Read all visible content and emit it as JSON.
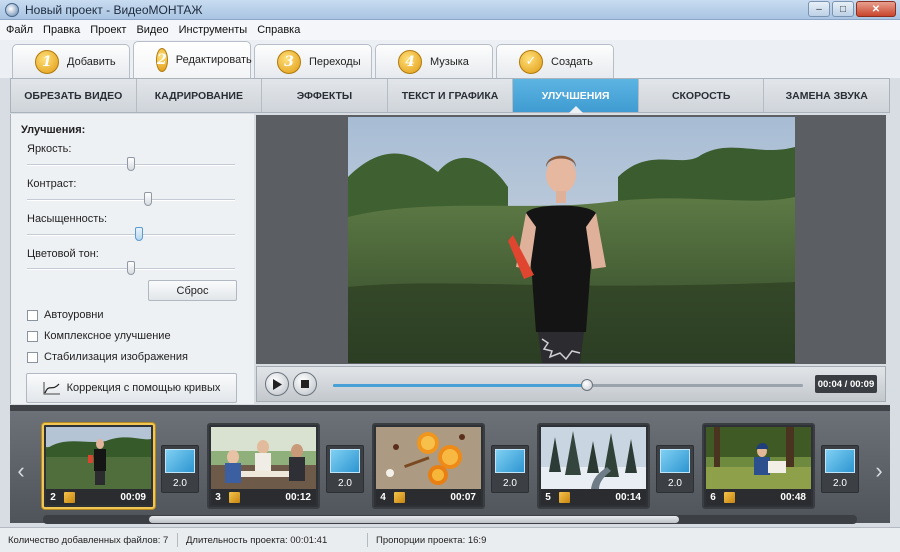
{
  "window": {
    "title": "Новый проект - ВидеоМОНТАЖ",
    "controls": [
      "minimize",
      "maximize",
      "close"
    ]
  },
  "menu": [
    "Файл",
    "Правка",
    "Проект",
    "Видео",
    "Инструменты",
    "Справка"
  ],
  "steps": [
    {
      "num": "1",
      "label": "Добавить"
    },
    {
      "num": "2",
      "label": "Редактировать",
      "active": true
    },
    {
      "num": "3",
      "label": "Переходы"
    },
    {
      "num": "4",
      "label": "Музыка"
    },
    {
      "num": "✓",
      "label": "Создать"
    }
  ],
  "subtabs": [
    "ОБРЕЗАТЬ ВИДЕО",
    "КАДРИРОВАНИЕ",
    "ЭФФЕКТЫ",
    "ТЕКСТ И ГРАФИКА",
    "УЛУЧШЕНИЯ",
    "СКОРОСТЬ",
    "ЗАМЕНА ЗВУКА"
  ],
  "active_subtab": "УЛУЧШЕНИЯ",
  "enhance": {
    "title": "Улучшения:",
    "sliders": [
      {
        "label": "Яркость:",
        "value": 0.5
      },
      {
        "label": "Контраст:",
        "value": 0.58
      },
      {
        "label": "Насыщенность:",
        "value": 0.54
      },
      {
        "label": "Цветовой тон:",
        "value": 0.5
      }
    ],
    "reset_label": "Сброс",
    "checkboxes": [
      {
        "label": "Автоуровни",
        "checked": false
      },
      {
        "label": "Комплексное улучшение",
        "checked": false
      },
      {
        "label": "Стабилизация изображения",
        "checked": false
      }
    ],
    "curves_label": "Коррекция с помощью кривых"
  },
  "player": {
    "time": "00:04 / 00:09",
    "progress": 0.54
  },
  "clips": [
    {
      "index": "2",
      "duration": "00:09",
      "selected": true,
      "scene": "field"
    },
    {
      "index": "3",
      "duration": "00:12",
      "scene": "family"
    },
    {
      "index": "4",
      "duration": "00:07",
      "scene": "oranges"
    },
    {
      "index": "5",
      "duration": "00:14",
      "scene": "winter"
    },
    {
      "index": "6",
      "duration": "00:48",
      "scene": "forest"
    }
  ],
  "transition_duration": "2.0",
  "status": {
    "files": "Количество добавленных файлов: 7",
    "duration": "Длительность проекта: 00:01:41",
    "ratio": "Пропорции проекта: 16:9"
  },
  "colors": {
    "accent": "#47a0d6",
    "active_tab": "#4aa7da",
    "selected_clip": "#f2c654"
  }
}
